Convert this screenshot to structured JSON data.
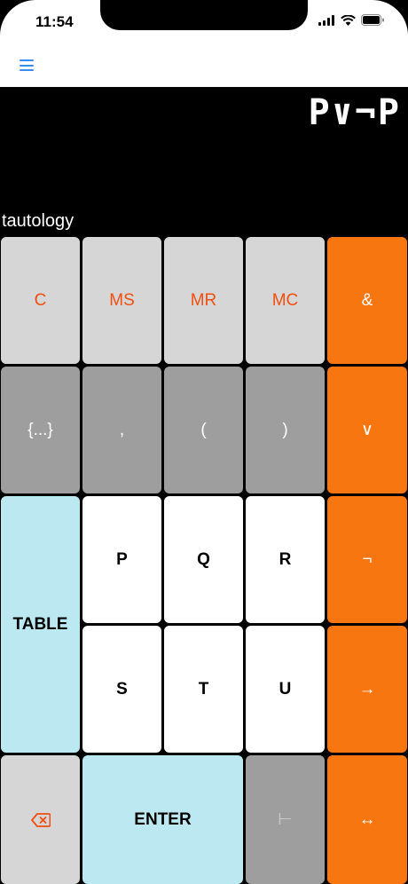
{
  "status": {
    "time": "11:54"
  },
  "display": {
    "expression": "P∨¬P",
    "result": "tautology"
  },
  "keys": {
    "row1": [
      "C",
      "MS",
      "MR",
      "MC"
    ],
    "row2": [
      "{...}",
      ",",
      "(",
      ")"
    ],
    "vars1": [
      "P",
      "Q",
      "R"
    ],
    "vars2": [
      "S",
      "T",
      "U"
    ],
    "table": "TABLE",
    "enter": "ENTER",
    "turnstile": "⊢",
    "ops": [
      "&",
      "∨",
      "¬",
      "→",
      "↔"
    ]
  },
  "icons": {
    "menu": "hamburger-icon",
    "backspace": "backspace-icon"
  },
  "colors": {
    "orange": "#f7760f",
    "blue": "#bce9f1",
    "light_gray": "#d6d6d6",
    "dark_gray": "#9e9e9e",
    "accent_text": "#f24e0f"
  }
}
